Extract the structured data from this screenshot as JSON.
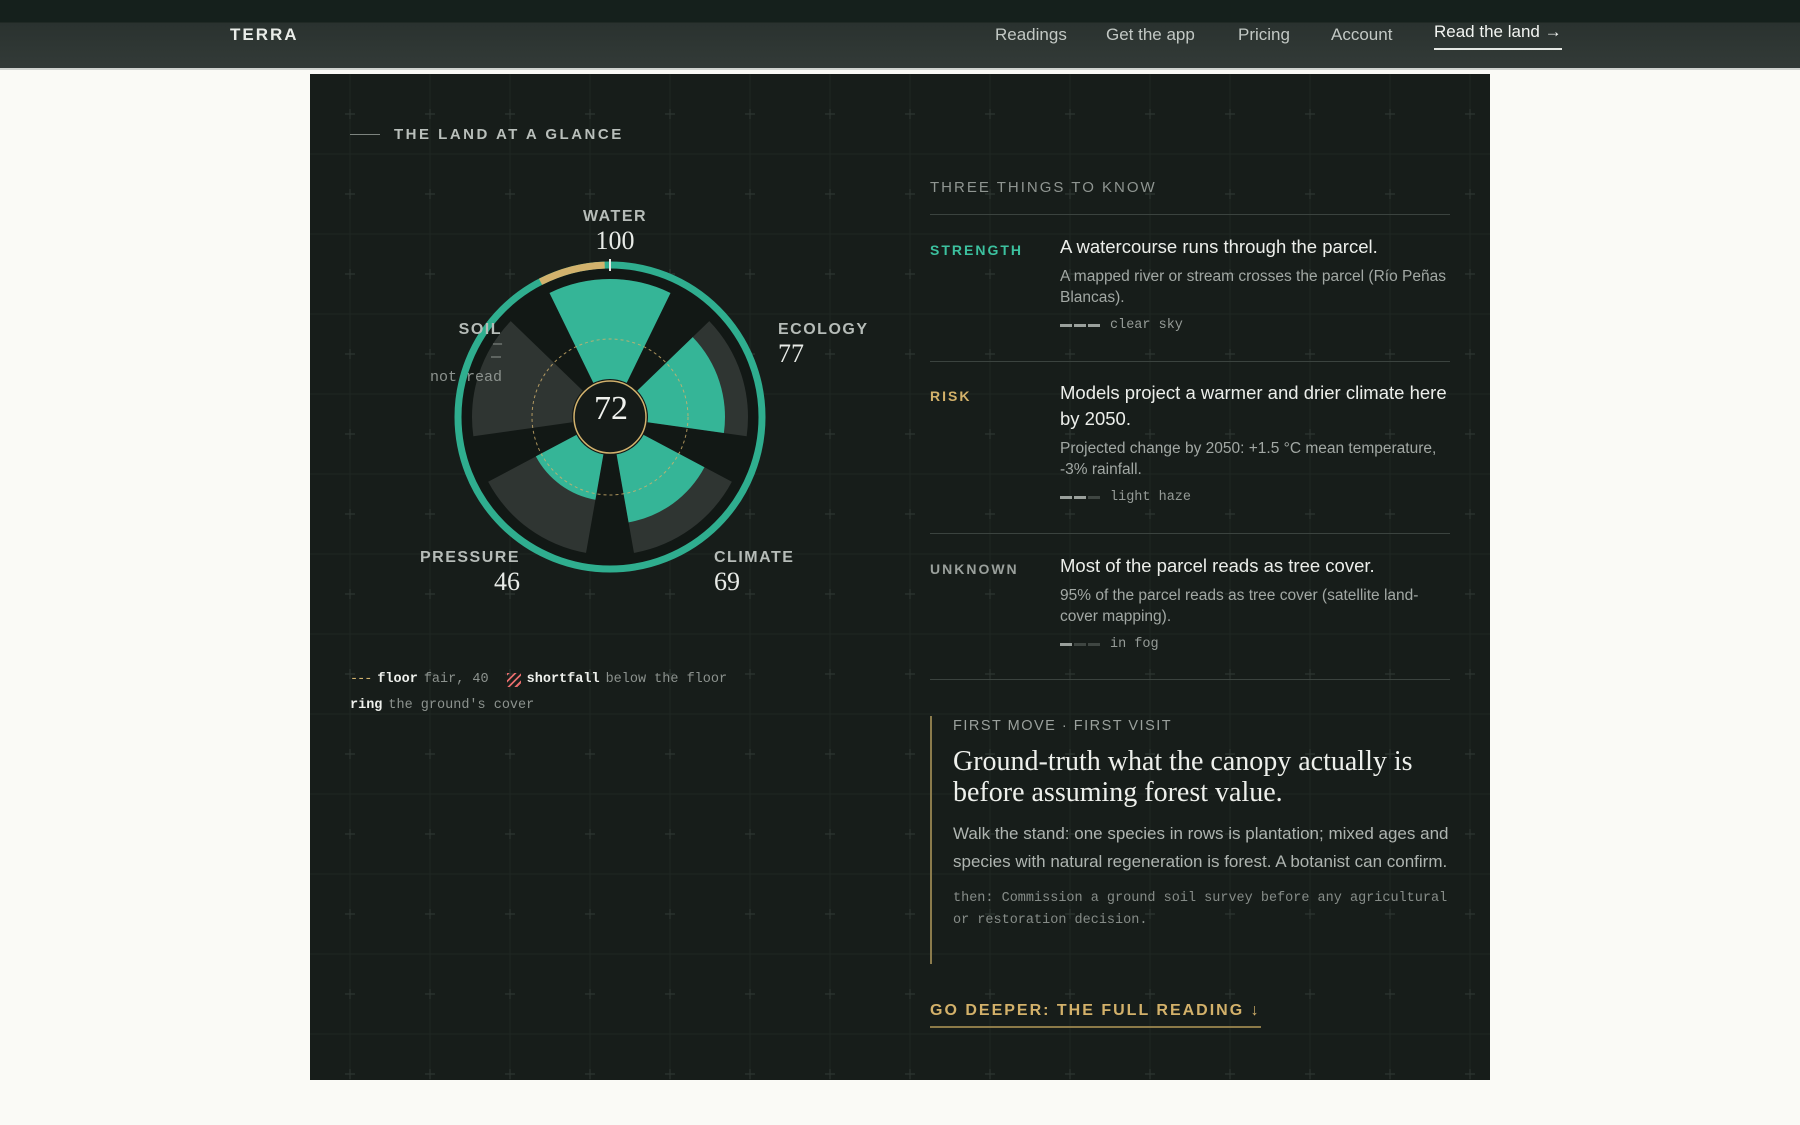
{
  "nav": {
    "brand": "TERRA",
    "links": [
      "Readings",
      "Get the app",
      "Pricing",
      "Account"
    ],
    "cta": "Read the land →"
  },
  "glance": {
    "eyebrow": "THE LAND AT A GLANCE",
    "overall_score": "72",
    "floor_value": 40,
    "axes": [
      {
        "key": "water",
        "label": "WATER",
        "value": "100",
        "score": 100
      },
      {
        "key": "ecology",
        "label": "ECOLOGY",
        "value": "77",
        "score": 77
      },
      {
        "key": "climate",
        "label": "CLIMATE",
        "value": "69",
        "score": 69
      },
      {
        "key": "pressure",
        "label": "PRESSURE",
        "value": "46",
        "score": 46
      },
      {
        "key": "soil",
        "label": "SOIL",
        "value": "—",
        "note": "not read",
        "score": null
      }
    ],
    "ring_cover_fraction": 0.93,
    "legend": {
      "floor_term": "floor",
      "floor_desc": "fair, 40",
      "shortfall_term": "shortfall",
      "shortfall_desc": "below the floor",
      "ring_term": "ring",
      "ring_desc": "the ground's cover"
    },
    "colors": {
      "fill": "#35b597",
      "ghost": "#3a3f3c",
      "ring": "#2fae8f",
      "gold": "#d2b26d"
    }
  },
  "things": {
    "heading": "THREE THINGS TO KNOW",
    "items": [
      {
        "tag": "STRENGTH",
        "tag_color": "#3cc19f",
        "title": "A watercourse runs through the parcel.",
        "detail": "A mapped river or stream crosses the parcel (Río Peñas Blancas).",
        "confidence": "clear sky",
        "confidence_level": 3
      },
      {
        "tag": "RISK",
        "tag_color": "#d3b16a",
        "title": "Models project a warmer and drier climate here by 2050.",
        "detail": "Projected change by 2050: +1.5 °C mean temperature, -3% rainfall.",
        "confidence": "light haze",
        "confidence_level": 2
      },
      {
        "tag": "UNKNOWN",
        "tag_color": "#9aa09c",
        "title": "Most of the parcel reads as tree cover.",
        "detail": "95% of the parcel reads as tree cover (satellite land-cover mapping).",
        "confidence": "in fog",
        "confidence_level": 1
      }
    ]
  },
  "first_move": {
    "kicker": "FIRST MOVE · FIRST VISIT",
    "title": "Ground-truth what the canopy actually is before assuming forest value.",
    "text": "Walk the stand: one species in rows is plantation; mixed ages and species with natural regeneration is forest. A botanist can confirm.",
    "then": "then: Commission a ground soil survey before any agricultural or restoration decision."
  },
  "deeper_link": "GO DEEPER: THE FULL READING ↓"
}
